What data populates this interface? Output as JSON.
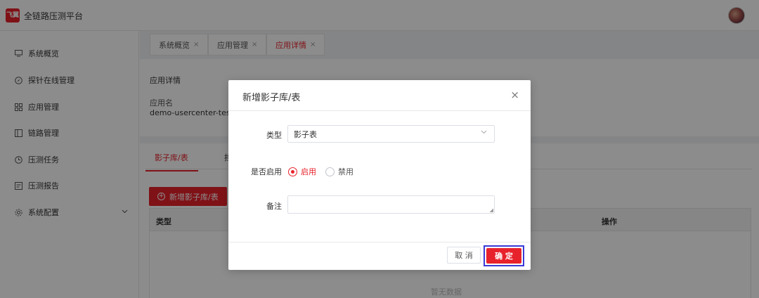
{
  "app": {
    "logo_text": "飞翼",
    "title": "全链路压测平台"
  },
  "sidebar": {
    "items": [
      {
        "label": "系统概览",
        "icon": "monitor-icon"
      },
      {
        "label": "探针在线管理",
        "icon": "compass-icon"
      },
      {
        "label": "应用管理",
        "icon": "grid-icon"
      },
      {
        "label": "链路管理",
        "icon": "link-icon"
      },
      {
        "label": "压测任务",
        "icon": "clock-icon"
      },
      {
        "label": "压测报告",
        "icon": "report-icon"
      },
      {
        "label": "系统配置",
        "icon": "gear-icon"
      }
    ]
  },
  "tabs": [
    {
      "label": "系统概览",
      "close": "×"
    },
    {
      "label": "应用管理",
      "close": "×"
    },
    {
      "label": "应用详情",
      "close": "×"
    }
  ],
  "detail": {
    "title": "应用详情",
    "app_name_label": "应用名",
    "app_name_value": "demo-usercenter-test"
  },
  "sub_tabs": {
    "active": "影子库/表",
    "partial": "挡"
  },
  "add_button": "新增影子库/表",
  "table": {
    "col_type": "类型",
    "col_action": "操作",
    "empty": "暂无数据"
  },
  "dialog": {
    "title": "新增影子库/表",
    "close": "×",
    "type_label": "类型",
    "type_value": "影子表",
    "enable_label": "是否启用",
    "radio_on": "启用",
    "radio_off": "禁用",
    "remark_label": "备注",
    "cancel": "取 消",
    "confirm": "确 定"
  },
  "colors": {
    "accent": "#e8222b",
    "focus_frame": "#3a3ad6"
  }
}
